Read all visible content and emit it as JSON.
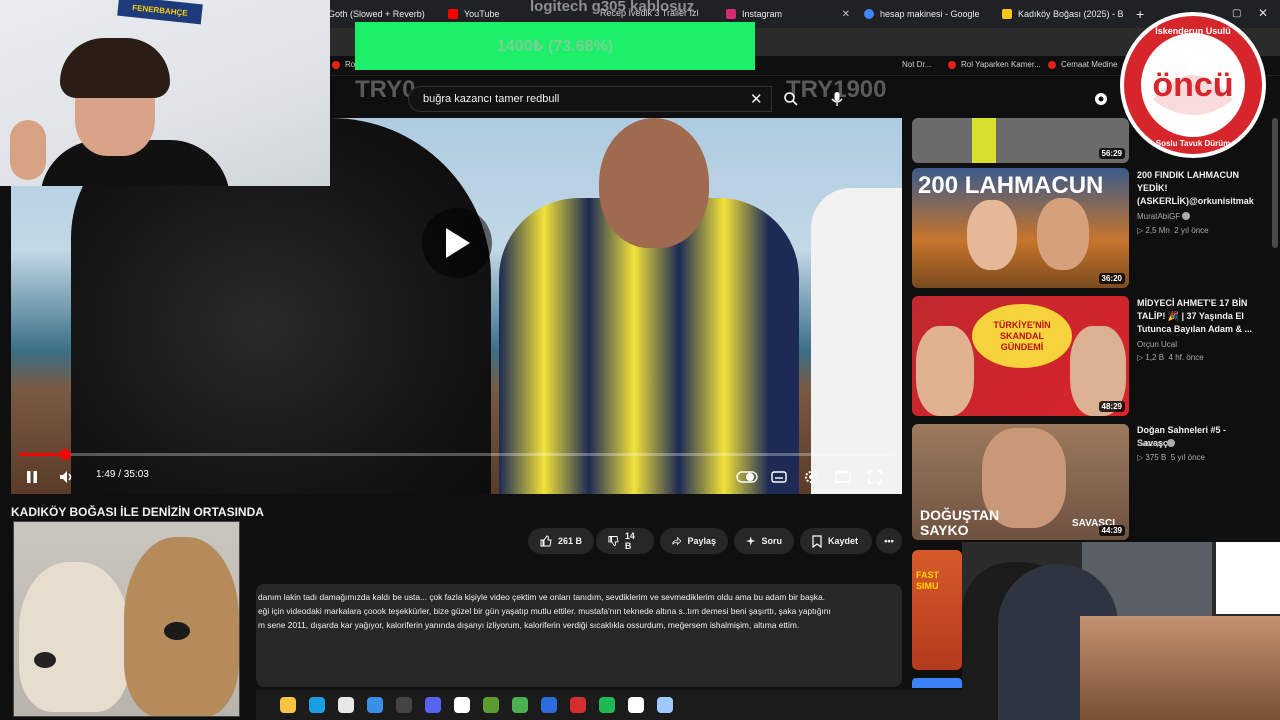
{
  "browser": {
    "tabs": [
      {
        "title": "Goth (Slowed + Reverb)",
        "favicon_color": "#ff0000"
      },
      {
        "title": "YouTube",
        "favicon_color": "#ff0000"
      },
      {
        "title": "Instagram",
        "favicon_color": "#d62976"
      },
      {
        "title": "hesap makinesi - Google",
        "favicon_color": "#4285f4"
      },
      {
        "title": "Kadıköy Boğası (2025) - B",
        "favicon_color": "#f5c518"
      }
    ],
    "bookmarks": [
      "Ro",
      "Not Dr...",
      "Rol Yaparken Kamer...",
      "Cemaat Medine"
    ]
  },
  "stream_overlay": {
    "title": "logitech g305 kablosuz",
    "subtitle": "Recep İvedik 3 Trailer İzl",
    "donation_text": "1400₺ (73.68%)",
    "left_label": "TRY0",
    "right_label": "TRY1900",
    "donation_progress": 0.7368,
    "sticker_text": "FENERBAHÇE",
    "sponsor": {
      "arc_top": "İskenderun Usulü",
      "brand": "öncü",
      "arc_bottom": "Soslu Tavuk Dürüm"
    }
  },
  "search": {
    "query": "buğra kazancı tamer redbull"
  },
  "player": {
    "time": "1:49 / 35:03",
    "progress": 0.052
  },
  "video": {
    "title": "KADIKÖY BOĞASI İLE DENİZİN ORTASINDA",
    "likes": "261 B",
    "dislikes": "14 B",
    "share_label": "Paylaş",
    "ask_label": "Soru",
    "save_label": "Kaydet"
  },
  "description": {
    "lines": [
      "danım lakin tadı damağımızda kaldı be usta... çok fazla kişiyle video çektim ve onları tanıdım, sevdiklerim ve sevmediklerim oldu ama bu adam bir başka.",
      "eği için videodaki markalara çoook teşekkürler, bize güzel bir gün yaşatıp mutlu ettiler. mustafa'nın teknede altına s..tım demesi beni şaşırttı, şaka yaptığını",
      "m sene 2011, dışarda kar yağıyor, kaloriferin yanında dışanyı izliyorum, kaloriferin verdiği sıcaklıkla ossurdum, meğersem ishalmişim, altıma ettim."
    ]
  },
  "recommendations": [
    {
      "duration": "56:29",
      "title": "",
      "channel": "",
      "views": "",
      "age": "",
      "thumb": "#6b6b6b"
    },
    {
      "duration": "36:20",
      "title": "200 FINDIK LAHMACUN YEDİK! (ASKERLİK)@orkunisitmak",
      "channel": "MuratAbiGF",
      "views": "2,5 Mn",
      "age": "2 yıl önce",
      "thumb": "#c8752d",
      "thumb_text": "200 LAHMACUN"
    },
    {
      "duration": "48:29",
      "title": "MİDYECİ AHMET'E 17 BİN TALİP! 🎉 | 37 Yaşında El Tutunca Bayılan Adam & ...",
      "channel": "Orçun Ucal",
      "views": "1,2 B",
      "age": "4 hf. önce",
      "thumb": "#c0282d",
      "thumb_text": "TÜRKİYE'NİN SKANDAL GÜNDEMİ"
    },
    {
      "duration": "44:39",
      "title": "Doğan Sahneleri #5 -Savaşçı",
      "channel": "Savaşçı",
      "views": "375 B",
      "age": "5 yıl önce",
      "thumb": "#8a6d55",
      "thumb_text": "DOĞUŞTAN SAYKO",
      "thumb_badge": "SAVAŞÇI"
    },
    {
      "duration": "",
      "title": "",
      "channel": "",
      "views": "",
      "age": "",
      "thumb": "#b23b1e",
      "thumb_text": "FAST SIMU"
    }
  ],
  "taskbar_icons": [
    {
      "name": "file-explorer-icon",
      "color": "#f5c542"
    },
    {
      "name": "edge-icon",
      "color": "#1aa0e0"
    },
    {
      "name": "capcut-icon",
      "color": "#e8e8e8"
    },
    {
      "name": "microsoft-store-icon",
      "color": "#3a8ee6"
    },
    {
      "name": "obs-icon",
      "color": "#444444"
    },
    {
      "name": "discord-icon",
      "color": "#5865f2"
    },
    {
      "name": "paint-icon",
      "color": "#ffffff"
    },
    {
      "name": "minecraft-icon",
      "color": "#5c9b2e"
    },
    {
      "name": "chrome-icon",
      "color": "#4caf50"
    },
    {
      "name": "ea-icon",
      "color": "#2d6cdf"
    },
    {
      "name": "app-red-icon",
      "color": "#d32f2f"
    },
    {
      "name": "spotify-icon",
      "color": "#1db954"
    },
    {
      "name": "capcut-2-icon",
      "color": "#ffffff"
    },
    {
      "name": "blue-app-icon",
      "color": "#9ec9ff"
    }
  ]
}
